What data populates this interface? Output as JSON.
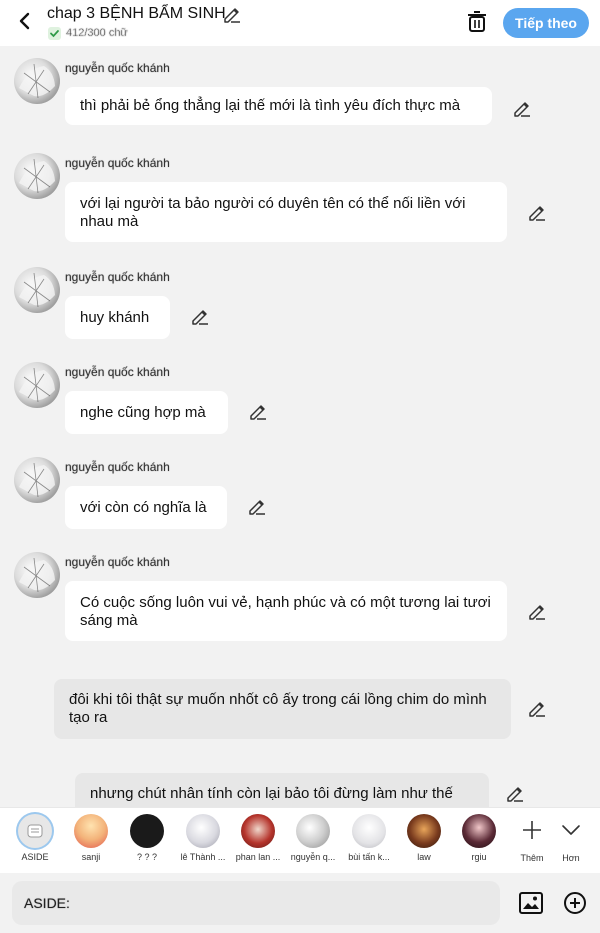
{
  "header": {
    "title": "chap 3 BỆNH BẨM SINH",
    "word_count": "412/300 chữ",
    "next_label": "Tiếp theo"
  },
  "messages": [
    {
      "sender": "nguyễn quốc khánh",
      "text": "thì phải bẻ ổng thẳng lại thế mới là tình yêu đích thực mà"
    },
    {
      "sender": "nguyễn quốc khánh",
      "text": "với lại người ta bảo người có duyên tên có thể nối liền với nhau mà"
    },
    {
      "sender": "nguyễn quốc khánh",
      "text": "huy khánh"
    },
    {
      "sender": "nguyễn quốc khánh",
      "text": "nghe cũng hợp mà"
    },
    {
      "sender": "nguyễn quốc khánh",
      "text": "với còn có nghĩa là"
    },
    {
      "sender": "nguyễn quốc khánh",
      "text": "Có cuộc sống luôn vui vẻ, hạnh phúc và có một tương lai tươi sáng mà"
    }
  ],
  "aside_messages": [
    {
      "text": "đôi khi tôi thật sự muốn nhốt cô ấy trong cái lồng chim do mình tạo ra"
    },
    {
      "text": "nhưng chút nhân tính còn lại bảo tôi đừng làm như thế"
    }
  ],
  "characters": [
    {
      "name": "ASIDE",
      "color": "#e6e6e6"
    },
    {
      "name": "sanji",
      "color": "#f3b37a"
    },
    {
      "name": "? ? ?",
      "color": "#1a1a1a"
    },
    {
      "name": "lê Thành ...",
      "color": "#d9d9e0"
    },
    {
      "name": "phan lan ...",
      "color": "#b5342c"
    },
    {
      "name": "nguyễn q...",
      "color": "#cfcfcf"
    },
    {
      "name": "bùi tấn k...",
      "color": "#e3e3e6"
    },
    {
      "name": "law",
      "color": "#7a3b1e"
    },
    {
      "name": "rgiu",
      "color": "#5b2a36"
    }
  ],
  "tools": {
    "more_label": "Thêm",
    "expand_label": "Hơn"
  },
  "input": {
    "value": "ASIDE:"
  }
}
